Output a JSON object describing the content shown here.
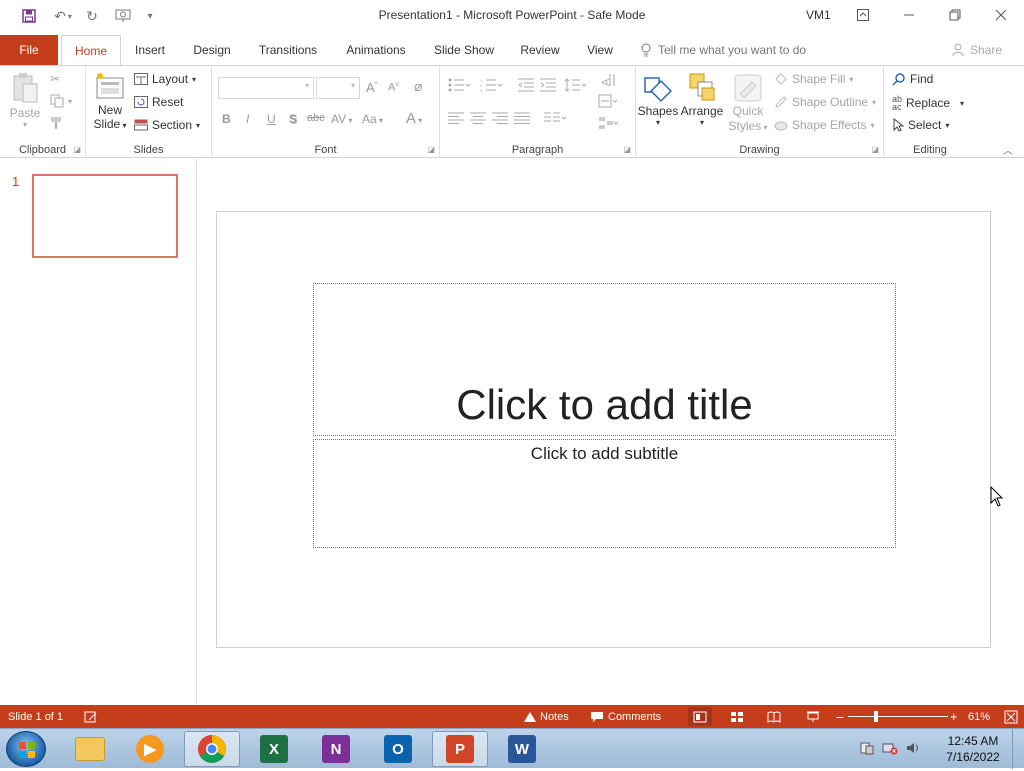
{
  "titlebar": {
    "title": "Presentation1  -  Microsoft PowerPoint  -  Safe Mode",
    "user": "VM1"
  },
  "tabs": {
    "file": "File",
    "items": [
      "Home",
      "Insert",
      "Design",
      "Transitions",
      "Animations",
      "Slide Show",
      "Review",
      "View"
    ],
    "active": "Home",
    "tell_me": "Tell me what you want to do",
    "share": "Share"
  },
  "ribbon": {
    "clipboard": {
      "label": "Clipboard",
      "paste": "Paste"
    },
    "slides": {
      "label": "Slides",
      "new_slide_1": "New",
      "new_slide_2": "Slide",
      "layout": "Layout",
      "reset": "Reset",
      "section": "Section"
    },
    "font": {
      "label": "Font",
      "bold": "B",
      "italic": "I",
      "underline": "U",
      "shadow": "S",
      "strike": "abc",
      "spacing": "AV",
      "case": "Aa",
      "color": "A",
      "grow": "A",
      "shrink": "A"
    },
    "paragraph": {
      "label": "Paragraph"
    },
    "drawing": {
      "label": "Drawing",
      "shapes": "Shapes",
      "arrange": "Arrange",
      "quick_styles_1": "Quick",
      "quick_styles_2": "Styles",
      "shape_fill": "Shape Fill",
      "shape_outline": "Shape Outline",
      "shape_effects": "Shape Effects"
    },
    "editing": {
      "label": "Editing",
      "find": "Find",
      "replace": "Replace",
      "select": "Select"
    }
  },
  "thumbnails": {
    "slide_number": "1"
  },
  "slide": {
    "title_placeholder": "Click to add title",
    "subtitle_placeholder": "Click to add subtitle"
  },
  "statusbar": {
    "slide_info": "Slide 1 of 1",
    "notes": "Notes",
    "comments": "Comments",
    "zoom": "61%"
  },
  "taskbar": {
    "apps": [
      "File Explorer",
      "Windows Media Player",
      "Google Chrome",
      "Excel",
      "OneNote",
      "Outlook",
      "PowerPoint",
      "Word"
    ],
    "time": "12:45 AM",
    "date": "7/16/2022"
  },
  "colors": {
    "accent": "#c43e1c",
    "thumb_border": "#d9796a"
  }
}
